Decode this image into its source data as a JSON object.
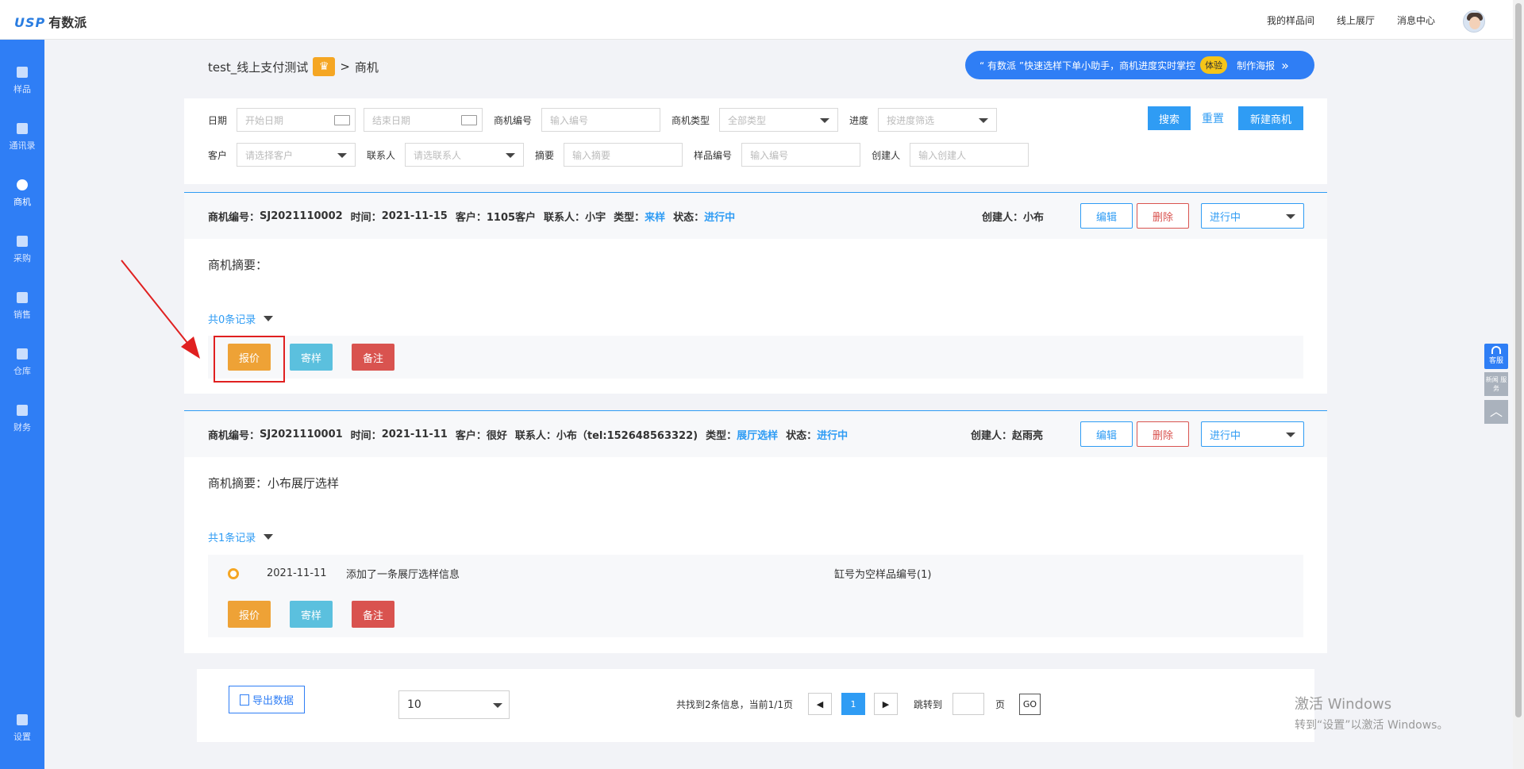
{
  "header": {
    "logo_prefix": "USP",
    "logo_name": "有数派",
    "links": [
      "我的样品间",
      "线上展厅",
      "消息中心"
    ]
  },
  "sidebar": {
    "items": [
      {
        "label": "样品",
        "icon": "sample-icon"
      },
      {
        "label": "通讯录",
        "icon": "contacts-icon"
      },
      {
        "label": "商机",
        "icon": "opportunity-icon"
      },
      {
        "label": "采购",
        "icon": "purchase-icon"
      },
      {
        "label": "销售",
        "icon": "sales-icon"
      },
      {
        "label": "仓库",
        "icon": "warehouse-icon"
      },
      {
        "label": "财务",
        "icon": "finance-icon"
      },
      {
        "label": "设置",
        "icon": "gear-icon"
      }
    ]
  },
  "breadcrumb": {
    "project": "test_线上支付测试",
    "separator": ">",
    "page": "商机"
  },
  "promo": {
    "text": "“ 有数派 ”快速选样下单小助手，商机进度实时掌控",
    "tag": "体验",
    "link": "制作海报"
  },
  "filters": {
    "date_label": "日期",
    "start_placeholder": "开始日期",
    "end_placeholder": "结束日期",
    "code_label": "商机编号",
    "code_placeholder": "输入编号",
    "type_label": "商机类型",
    "type_value": "全部类型",
    "progress_label": "进度",
    "progress_value": "按进度筛选",
    "customer_label": "客户",
    "customer_value": "请选择客户",
    "contact_label": "联系人",
    "contact_value": "请选联系人",
    "summary_label": "摘要",
    "summary_placeholder": "输入摘要",
    "sample_label": "样品编号",
    "sample_placeholder": "输入编号",
    "creator_label": "创建人",
    "creator_placeholder": "输入创建人",
    "search_button": "搜索",
    "reset_button": "重置",
    "new_button": "新建商机"
  },
  "records": [
    {
      "code_label": "商机编号：",
      "code": "SJ2021110002",
      "time_label": "时间：",
      "time": "2021-11-15",
      "customer_label": "客户：",
      "customer": "1105客户",
      "contact_label": "联系人：",
      "contact": "小宇",
      "type_label": "类型：",
      "type": "来样",
      "status_label": "状态：",
      "status": "进行中",
      "creator_label": "创建人：",
      "creator": "小布",
      "edit": "编辑",
      "delete": "删除",
      "progress": "进行中",
      "summary_label": "商机摘要：",
      "summary": "",
      "record_count": "共0条记录",
      "actions": [
        "报价",
        "寄样",
        "备注"
      ]
    },
    {
      "code_label": "商机编号：",
      "code": "SJ2021110001",
      "time_label": "时间：",
      "time": "2021-11-11",
      "customer_label": "客户：",
      "customer": "很好",
      "contact_label": "联系人：",
      "contact": "小布（tel:152648563322)",
      "type_label": "类型：",
      "type": "展厅选样",
      "status_label": "状态：",
      "status": "进行中",
      "creator_label": "创建人：",
      "creator": "赵雨亮",
      "edit": "编辑",
      "delete": "删除",
      "progress": "进行中",
      "summary_label": "商机摘要：",
      "summary": "小布展厅选样",
      "record_count": "共1条记录",
      "log": {
        "date": "2021-11-11",
        "text": "添加了一条展厅选样信息",
        "note": "缸号为空样品编号(1)"
      },
      "actions": [
        "报价",
        "寄样",
        "备注"
      ]
    }
  ],
  "pager": {
    "export": "导出数据",
    "page_size": "10",
    "info": "共找到2条信息，当前1/1页",
    "current_page": "1",
    "jump_label": "跳转到",
    "page_unit": "页",
    "go": "GO"
  },
  "float": {
    "service": "客服",
    "sample_service": "新闻 服务"
  },
  "watermark": {
    "line1": "激活 Windows",
    "line2": "转到“设置”以激活 Windows。"
  },
  "colors": {
    "primary": "#2f7ef5",
    "accent": "#2f9cf4",
    "orange": "#eea236",
    "cyan": "#5bc0de",
    "red": "#d9534f"
  }
}
